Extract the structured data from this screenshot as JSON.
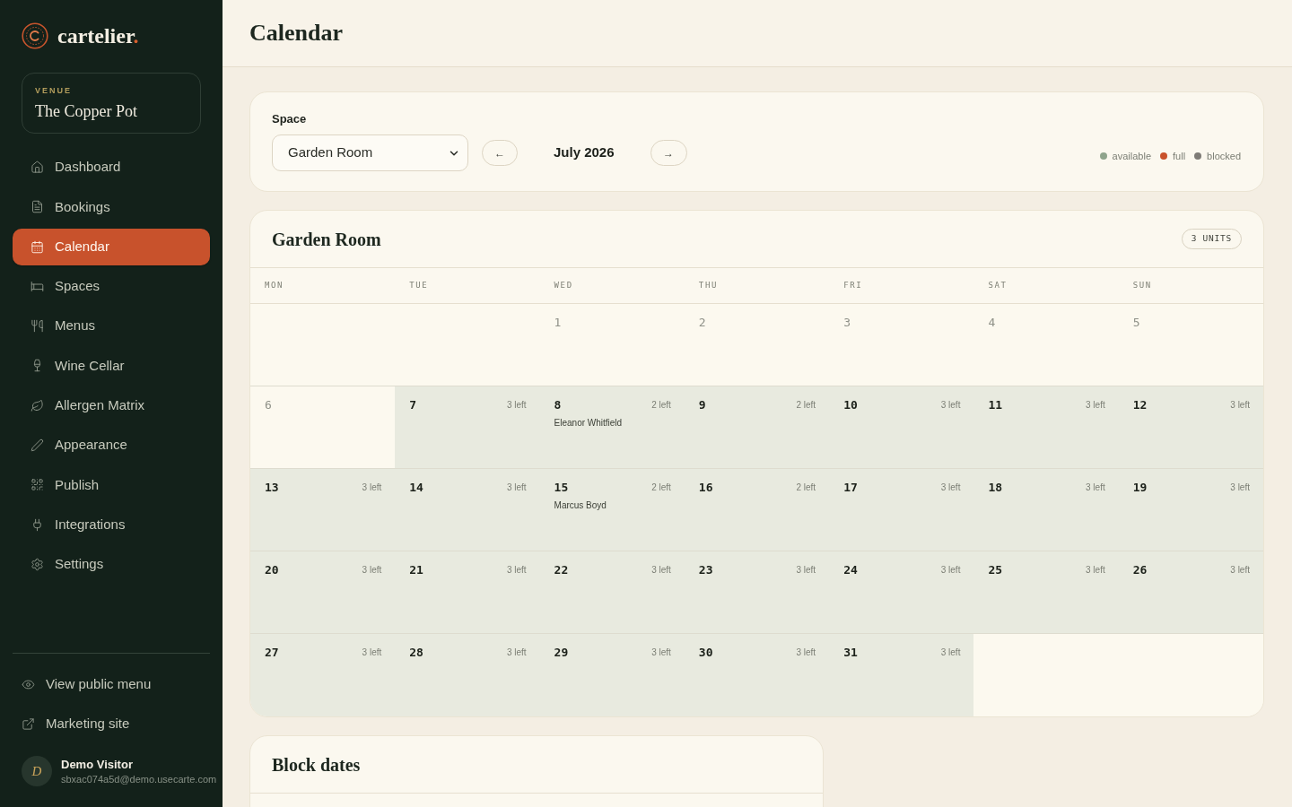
{
  "sidebar": {
    "brand": {
      "name": "cartelier",
      "suffix": "."
    },
    "venue": {
      "label": "VENUE",
      "name": "The Copper Pot"
    },
    "nav": [
      {
        "label": "Dashboard",
        "selected": false
      },
      {
        "label": "Bookings",
        "selected": false
      },
      {
        "label": "Calendar",
        "selected": true
      },
      {
        "label": "Spaces",
        "selected": false
      },
      {
        "label": "Menus",
        "selected": false
      },
      {
        "label": "Wine Cellar",
        "selected": false
      },
      {
        "label": "Allergen Matrix",
        "selected": false
      },
      {
        "label": "Appearance",
        "selected": false
      },
      {
        "label": "Publish",
        "selected": false
      },
      {
        "label": "Integrations",
        "selected": false
      },
      {
        "label": "Settings",
        "selected": false
      }
    ],
    "footer_links": [
      {
        "label": "View public menu"
      },
      {
        "label": "Marketing site"
      }
    ],
    "user": {
      "initial": "D",
      "name": "Demo Visitor",
      "email": "sbxac074a5d@demo.usecarte.com"
    }
  },
  "header": {
    "title": "Calendar"
  },
  "controls": {
    "space_label": "Space",
    "space_value": "Garden Room",
    "prev": "←",
    "month": "July 2026",
    "next": "→",
    "legend": [
      {
        "label": "available",
        "color": "#8fa48c"
      },
      {
        "label": "full",
        "color": "#c9522b"
      },
      {
        "label": "blocked",
        "color": "#7e7b76"
      }
    ]
  },
  "calendar": {
    "title": "Garden Room",
    "badge": "3 UNITS",
    "weekdays": [
      "MON",
      "TUE",
      "WED",
      "THU",
      "FRI",
      "SAT",
      "SUN"
    ],
    "weeks": [
      {
        "days": [
          {
            "kind": "blank"
          },
          {
            "kind": "blank"
          },
          {
            "kind": "day",
            "date": "1",
            "past": true
          },
          {
            "kind": "day",
            "date": "2",
            "past": true
          },
          {
            "kind": "day",
            "date": "3",
            "past": true
          },
          {
            "kind": "day",
            "date": "4",
            "past": true
          },
          {
            "kind": "day",
            "date": "5",
            "past": true
          }
        ]
      },
      {
        "days": [
          {
            "kind": "day",
            "date": "6",
            "past": true
          },
          {
            "kind": "day",
            "date": "7",
            "past": false,
            "remaining": "3 left"
          },
          {
            "kind": "day",
            "date": "8",
            "past": false,
            "remaining": "2 left",
            "booking": "Eleanor Whitfield"
          },
          {
            "kind": "day",
            "date": "9",
            "past": false,
            "remaining": "2 left"
          },
          {
            "kind": "day",
            "date": "10",
            "past": false,
            "remaining": "3 left"
          },
          {
            "kind": "day",
            "date": "11",
            "past": false,
            "remaining": "3 left"
          },
          {
            "kind": "day",
            "date": "12",
            "past": false,
            "remaining": "3 left"
          }
        ]
      },
      {
        "days": [
          {
            "kind": "day",
            "date": "13",
            "past": false,
            "remaining": "3 left"
          },
          {
            "kind": "day",
            "date": "14",
            "past": false,
            "remaining": "3 left"
          },
          {
            "kind": "day",
            "date": "15",
            "past": false,
            "remaining": "2 left",
            "booking": "Marcus Boyd"
          },
          {
            "kind": "day",
            "date": "16",
            "past": false,
            "remaining": "2 left"
          },
          {
            "kind": "day",
            "date": "17",
            "past": false,
            "remaining": "3 left"
          },
          {
            "kind": "day",
            "date": "18",
            "past": false,
            "remaining": "3 left"
          },
          {
            "kind": "day",
            "date": "19",
            "past": false,
            "remaining": "3 left"
          }
        ]
      },
      {
        "days": [
          {
            "kind": "day",
            "date": "20",
            "past": false,
            "remaining": "3 left"
          },
          {
            "kind": "day",
            "date": "21",
            "past": false,
            "remaining": "3 left"
          },
          {
            "kind": "day",
            "date": "22",
            "past": false,
            "remaining": "3 left"
          },
          {
            "kind": "day",
            "date": "23",
            "past": false,
            "remaining": "3 left"
          },
          {
            "kind": "day",
            "date": "24",
            "past": false,
            "remaining": "3 left"
          },
          {
            "kind": "day",
            "date": "25",
            "past": false,
            "remaining": "3 left"
          },
          {
            "kind": "day",
            "date": "26",
            "past": false,
            "remaining": "3 left"
          }
        ]
      },
      {
        "days": [
          {
            "kind": "day",
            "date": "27",
            "past": false,
            "remaining": "3 left"
          },
          {
            "kind": "day",
            "date": "28",
            "past": false,
            "remaining": "3 left"
          },
          {
            "kind": "day",
            "date": "29",
            "past": false,
            "remaining": "3 left"
          },
          {
            "kind": "day",
            "date": "30",
            "past": false,
            "remaining": "3 left"
          },
          {
            "kind": "day",
            "date": "31",
            "past": false,
            "remaining": "3 left"
          },
          {
            "kind": "blank"
          },
          {
            "kind": "blank"
          }
        ]
      }
    ]
  },
  "block_dates": {
    "title": "Block dates"
  }
}
